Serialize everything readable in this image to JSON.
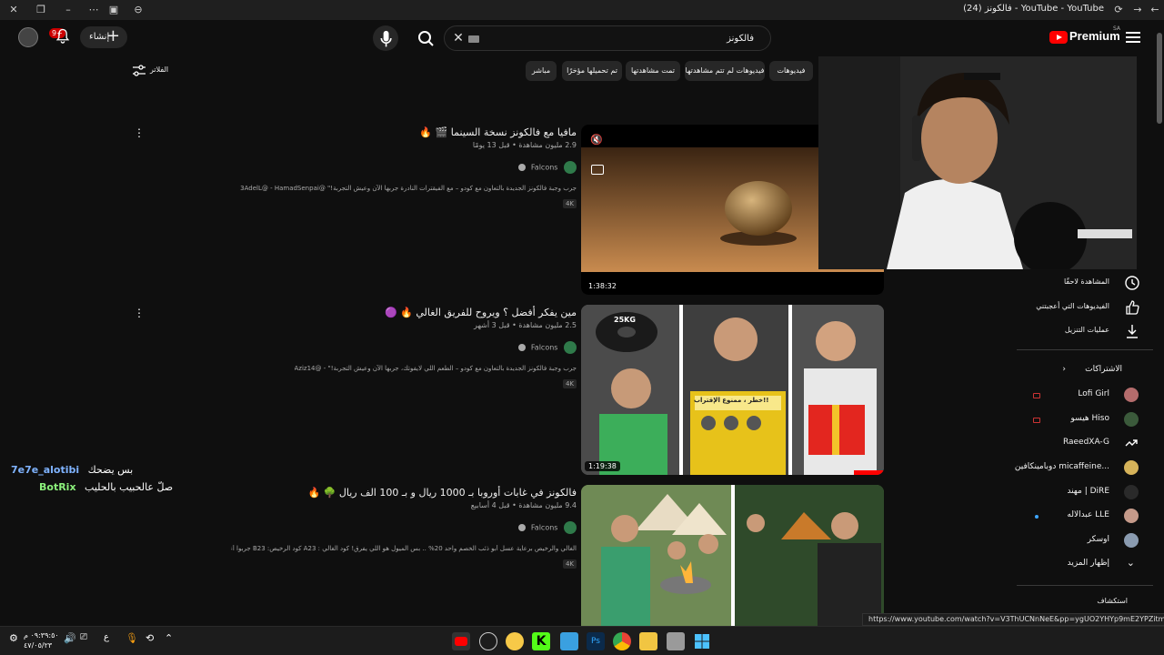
{
  "browser": {
    "tab_title": "(24) فالكونز - YouTube - YouTube"
  },
  "header": {
    "logo_text": "Premium",
    "logo_region": "SA",
    "notification_count": "9+",
    "create_label": "إنشاء",
    "search_query": "فالكونز"
  },
  "filters": {
    "chips": [
      "فيديوهات",
      "فيديوهات لم تتم مشاهدتها",
      "تمت مشاهدتها",
      "تم تحميلها مؤخرًا",
      "مباشر"
    ],
    "filter_label": "الفلاتر"
  },
  "results": [
    {
      "title": "مافيا مع فالكونز نسخة السينما 🎬 🔥",
      "meta": "2.9 مليون مشاهدة • قبل 13 يومًا",
      "channel": "Falcons",
      "description": "جرب وجبة فالكونز الجديدة بالتعاون مع كودو – مع الفيقترات النادرة جربها الآن وعيش التجربة!\" @3AdelL@ - HamadSenpai",
      "badge": "4K",
      "duration": "1:38:32"
    },
    {
      "title": "مين يفكر أفضل ؟ ويروح للفريق الغالي 🔥 🟣",
      "meta": "2.5 مليون مشاهدة • قبل 3 أشهر",
      "channel": "Falcons",
      "description": "جرب وجبة فالكونز الجديدة بالتعاون مع كودو – الطعم اللي لايفوتك، جربها الآن وعيش التجربة!\" - @Aziz14",
      "badge": "4K",
      "duration": "1:19:38"
    },
    {
      "title": "فالكونز في غابات أوروبا بـ 1000 ريال و بـ 100 الف ريال 🌳 🔥",
      "meta": "9.4 مليون مشاهدة • قبل 4 أسابيع",
      "channel": "Falcons",
      "description": "الغالي والرخيص برعاية عسل أبو ذئب الخصم واحد 20% .. بس الميول هو اللي يفرق! كود الغالي : A23 كود الرخيص: B23 جربوا أعسال ...",
      "badge": "4K",
      "duration": ""
    }
  ],
  "thumbnail_text": {
    "weight_label": "25KG",
    "warning_label": "خطر ، ممنوع الإقتراب!!"
  },
  "sidebar": {
    "items": [
      {
        "label": "المشاهدة لاحقًا",
        "icon": "clock-icon"
      },
      {
        "label": "الفيديوهات التي أعجبتني",
        "icon": "thumbs-up-icon"
      },
      {
        "label": "عمليات التنزيل",
        "icon": "download-icon"
      }
    ],
    "subscriptions_label": "الاشتراكات",
    "subscriptions": [
      {
        "name": "Lofi Girl",
        "live": true
      },
      {
        "name": "هيسو Hiso",
        "live": true
      },
      {
        "name": "RaeedXA-G",
        "live": false
      },
      {
        "name": "دوبامينكافين micaffeine...",
        "live": false
      },
      {
        "name": "مهند | DiRE",
        "live": false
      },
      {
        "name": "عبدالاله LLE",
        "live": false,
        "new": true
      },
      {
        "name": "اوسكر",
        "live": false
      }
    ],
    "show_more_label": "إظهار المزيد",
    "explore_label": "استكشاف"
  },
  "chat": [
    {
      "user": "7e7e_alotibi",
      "message": "بس يضحك",
      "color": "#7fb3ff"
    },
    {
      "user": "BotRix",
      "message": "صلّ عالحبيب بالحليب",
      "color": "#8bf07b"
    }
  ],
  "status_url": "https://www.youtube.com/watch?v=V3ThUCNnNeE&pp=ygUO2YHYp9mE2YPZitmG2LI%3D",
  "taskbar": {
    "time": "٠٩:٣٩:٥٠ م",
    "date": "٤٧/٠٥/٢٣",
    "lang": "ع"
  }
}
